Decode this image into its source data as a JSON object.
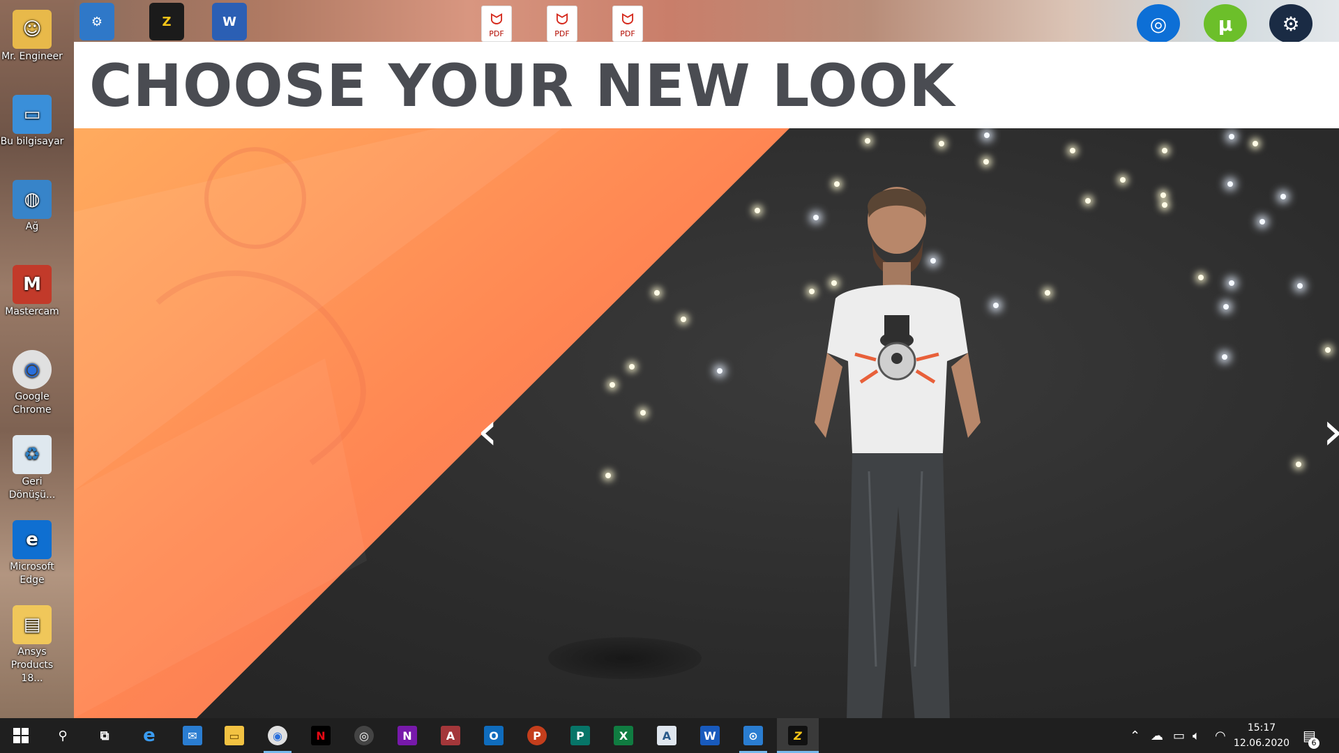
{
  "window": {
    "title": "CHOOSE YOUR NEW LOOK"
  },
  "colors": {
    "accent_orange": "#ff8a4a",
    "title_gray": "#4a4c52",
    "taskbar_bg": "#1f1f1f",
    "active_indicator": "#76b9ed"
  },
  "desktop_icons": [
    {
      "label": "Mr. Engineer",
      "icon": "folder-user-icon"
    },
    {
      "label": "Bu bilgisayar",
      "icon": "computer-icon"
    },
    {
      "label": "Ağ",
      "icon": "network-icon"
    },
    {
      "label": "Mastercam",
      "icon": "mastercam-icon"
    },
    {
      "label": "Google Chrome",
      "icon": "chrome-icon"
    },
    {
      "label": "Geri Dönüşü...",
      "icon": "recycle-bin-icon"
    },
    {
      "label": "Microsoft Edge",
      "icon": "edge-icon"
    },
    {
      "label": "Ansys Products 18...",
      "icon": "folder-icon"
    }
  ],
  "top_icons": {
    "pdf_label": "PDF",
    "left_apps": [
      "control-panel-icon",
      "zula-icon",
      "word-doc-icon"
    ],
    "right_apps": [
      "uplay-icon",
      "utorrent-icon",
      "steam-icon"
    ]
  },
  "taskbar": {
    "apps": [
      {
        "name": "search-icon",
        "glyph": "⚲"
      },
      {
        "name": "task-view-icon",
        "glyph": "⧉"
      },
      {
        "name": "edge-icon",
        "glyph": "e"
      },
      {
        "name": "mail-icon",
        "glyph": "✉"
      },
      {
        "name": "file-explorer-icon",
        "glyph": "▭"
      },
      {
        "name": "chrome-icon",
        "glyph": "◉"
      },
      {
        "name": "netflix-icon",
        "glyph": "N"
      },
      {
        "name": "groove-icon",
        "glyph": "◎"
      },
      {
        "name": "onenote-icon",
        "glyph": "N"
      },
      {
        "name": "access-icon",
        "glyph": "A"
      },
      {
        "name": "outlook-icon",
        "glyph": "O"
      },
      {
        "name": "powerpoint-icon",
        "glyph": "P"
      },
      {
        "name": "publisher-icon",
        "glyph": "P"
      },
      {
        "name": "excel-icon",
        "glyph": "X"
      },
      {
        "name": "notes-icon",
        "glyph": "A"
      },
      {
        "name": "word-icon",
        "glyph": "W"
      },
      {
        "name": "camera-icon",
        "glyph": "⊙"
      },
      {
        "name": "zula-icon",
        "glyph": "Z"
      }
    ],
    "clock_time": "15:17",
    "clock_date": "12.06.2020",
    "notification_count": "6"
  }
}
